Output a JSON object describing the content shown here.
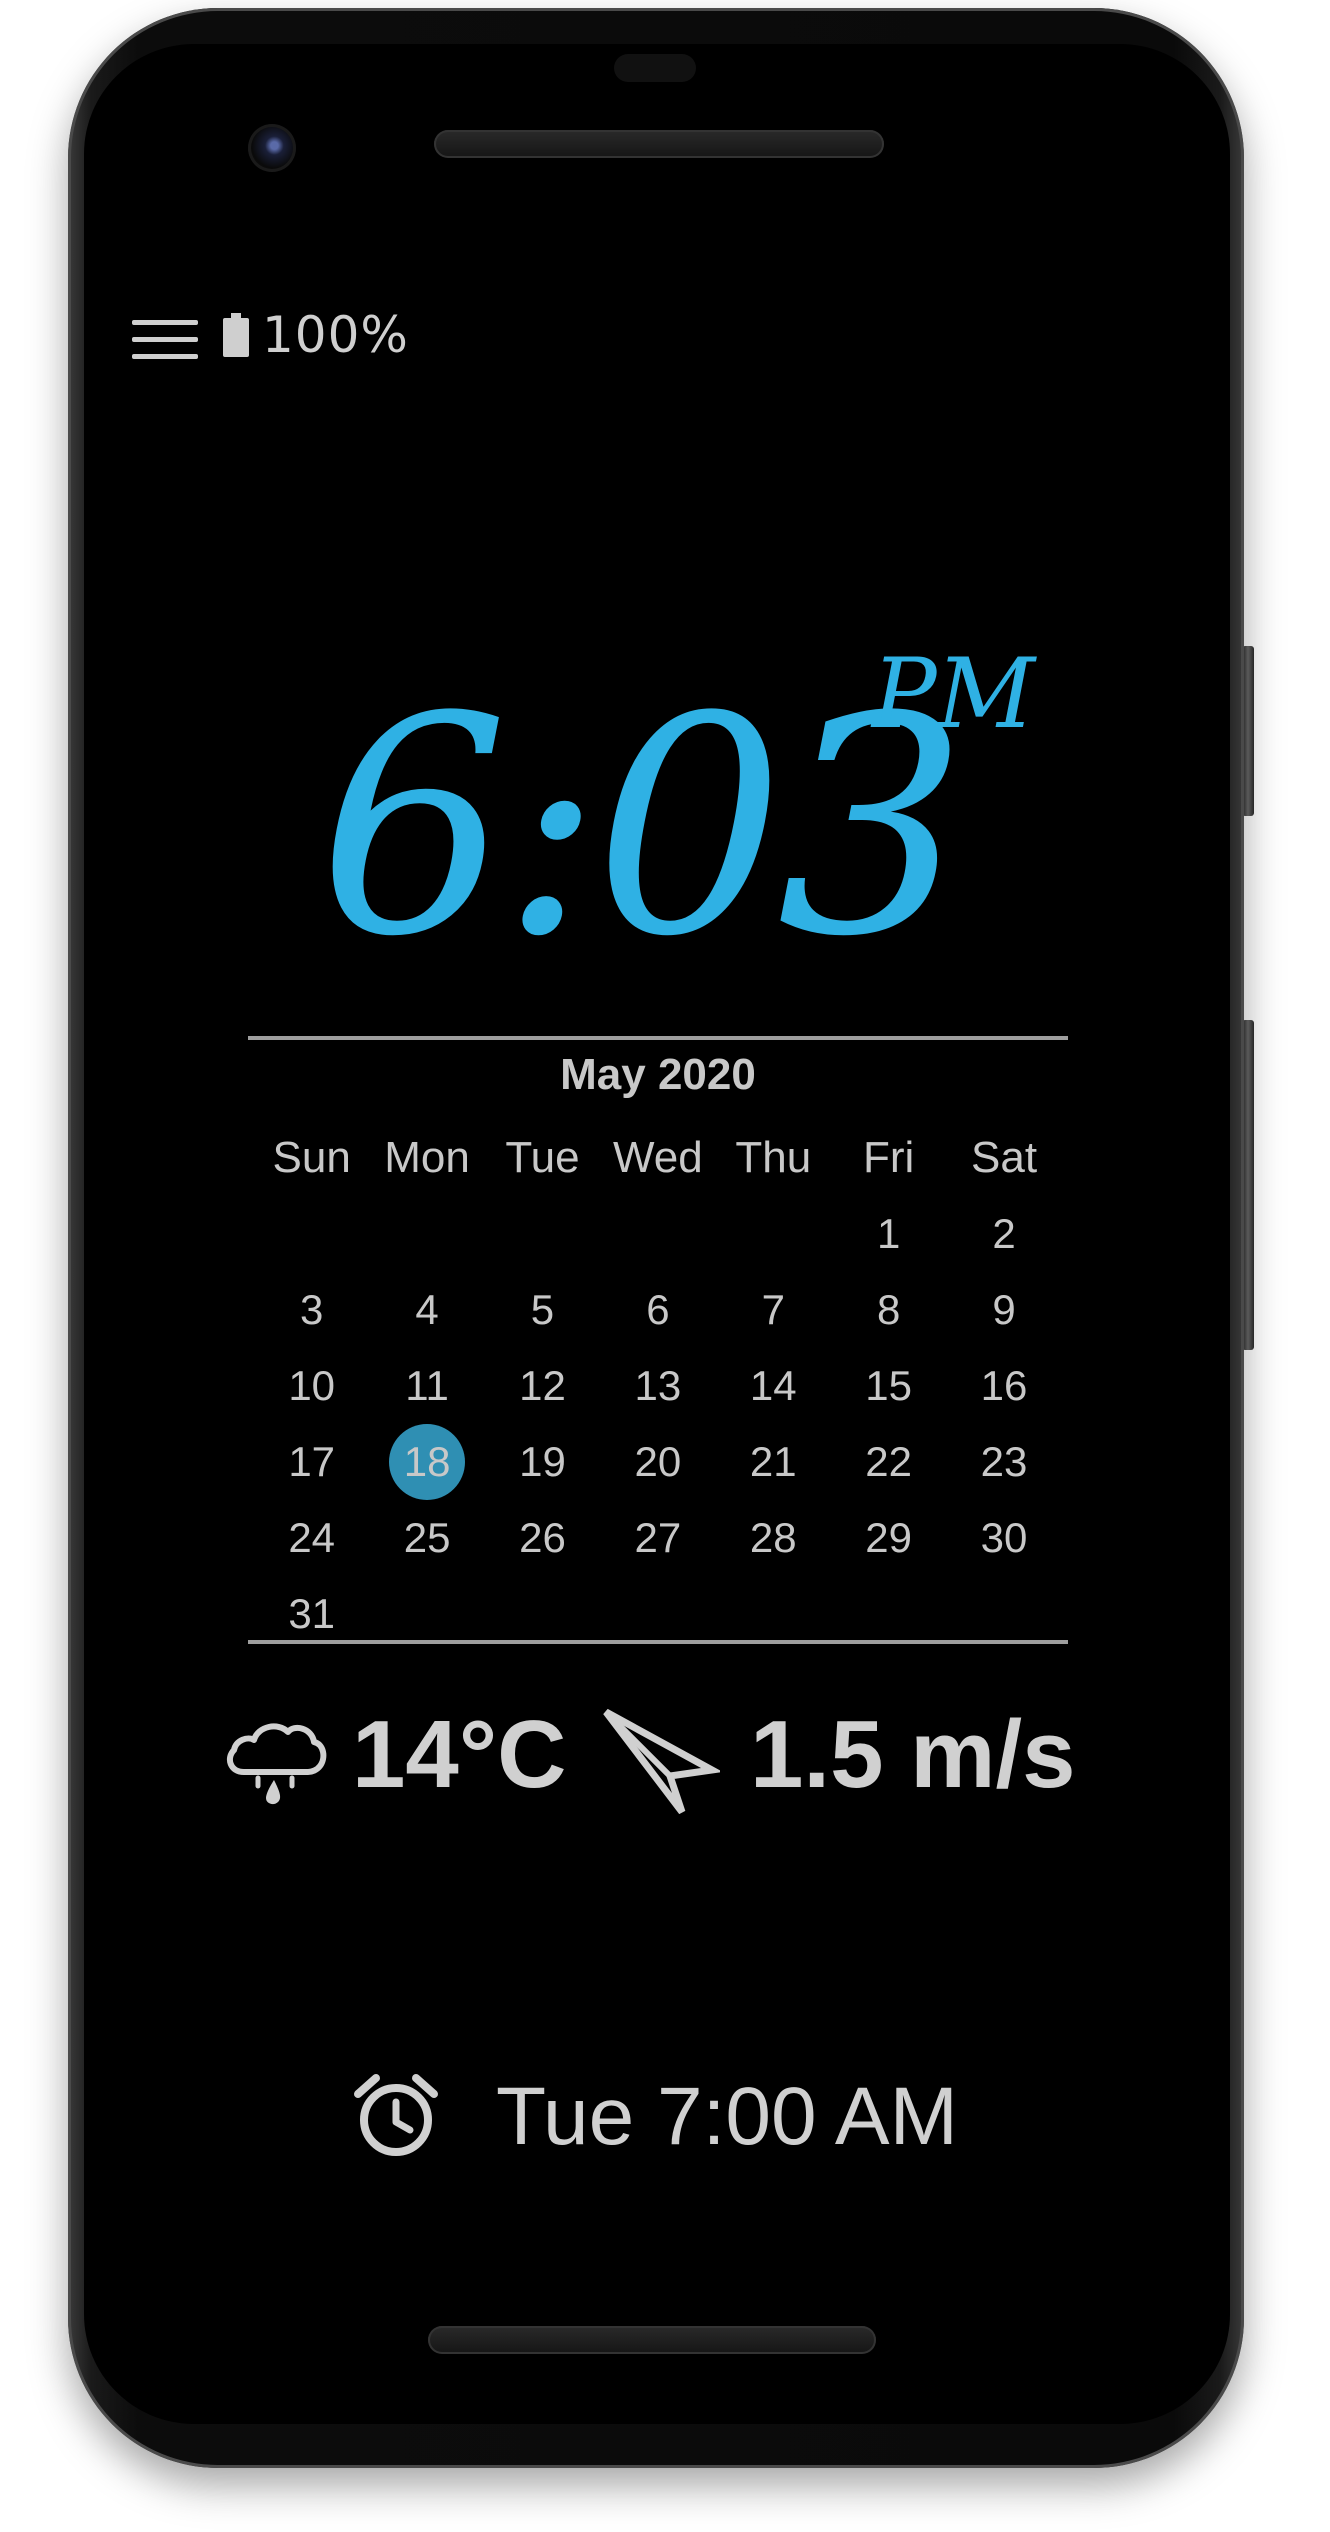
{
  "status": {
    "battery_percent": "100%",
    "menu_icon": "hamburger-menu-icon",
    "battery_icon": "battery-full-icon"
  },
  "clock": {
    "time": "6:03",
    "ampm": "PM",
    "color": "#2fb1e4"
  },
  "calendar": {
    "title": "May 2020",
    "weekdays": [
      "Sun",
      "Mon",
      "Tue",
      "Wed",
      "Thu",
      "Fri",
      "Sat"
    ],
    "weeks": [
      [
        "",
        "",
        "",
        "",
        "",
        "1",
        "2"
      ],
      [
        "3",
        "4",
        "5",
        "6",
        "7",
        "8",
        "9"
      ],
      [
        "10",
        "11",
        "12",
        "13",
        "14",
        "15",
        "16"
      ],
      [
        "17",
        "18",
        "19",
        "20",
        "21",
        "22",
        "23"
      ],
      [
        "24",
        "25",
        "26",
        "27",
        "28",
        "29",
        "30"
      ],
      [
        "31",
        "",
        "",
        "",
        "",
        "",
        ""
      ]
    ],
    "today": "18",
    "today_color": "#2f8fb3"
  },
  "weather": {
    "icon": "rain-cloud-icon",
    "temperature": "14°C",
    "wind_icon": "wind-direction-arrow-icon",
    "wind_speed": "1.5 m/s"
  },
  "alarm": {
    "icon": "alarm-clock-icon",
    "next_alarm": "Tue 7:00 AM"
  }
}
